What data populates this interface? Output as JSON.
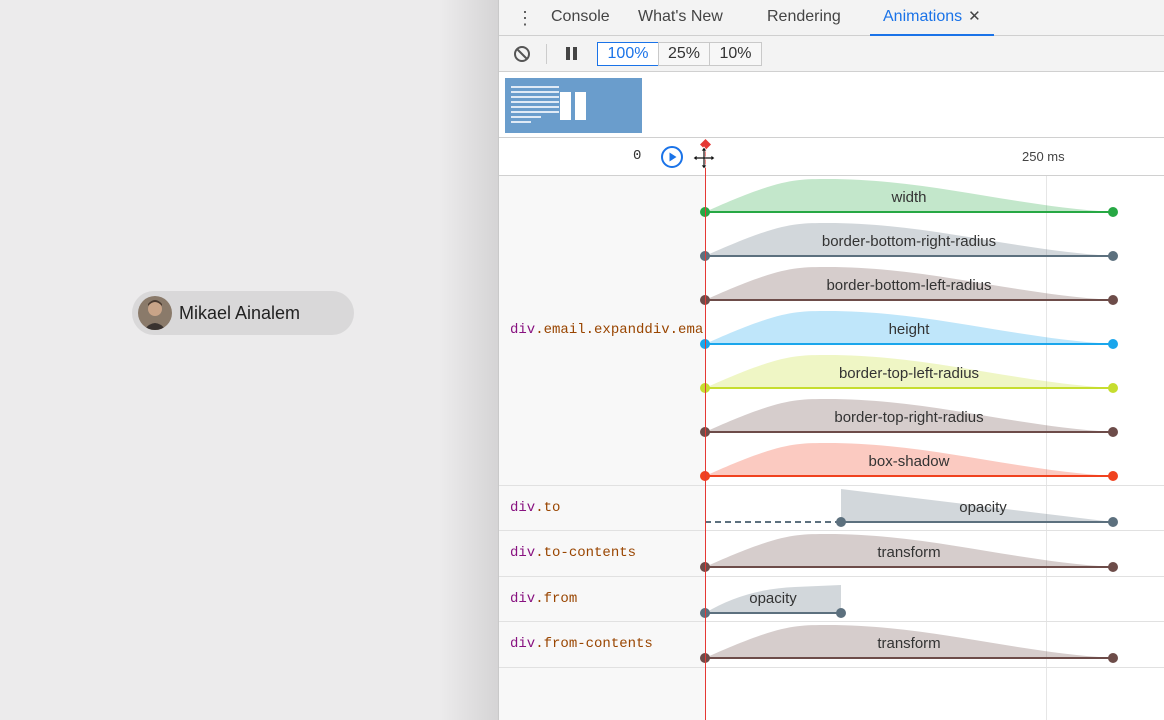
{
  "page": {
    "user_name": "Mikael Ainalem"
  },
  "devtools": {
    "tabs": [
      {
        "label": "Console"
      },
      {
        "label": "What's New"
      },
      {
        "label": "Rendering"
      },
      {
        "label": "Animations",
        "close": "✕"
      }
    ],
    "speeds": [
      "100%",
      "25%",
      "10%"
    ],
    "selected_speed": "100%",
    "timeline": {
      "start_label": "0",
      "tick_label": "250 ms"
    },
    "rows": [
      {
        "tag": "div",
        "label_rest": ".email.expanddiv.email.expand",
        "animations": [
          {
            "name": "width",
            "color": "#27a844"
          },
          {
            "name": "border-bottom-right-radius",
            "color": "#5c707e"
          },
          {
            "name": "border-bottom-left-radius",
            "color": "#6d4c49"
          },
          {
            "name": "height",
            "color": "#1aa6ec"
          },
          {
            "name": "border-top-left-radius",
            "color": "#c6dd2f"
          },
          {
            "name": "border-top-right-radius",
            "color": "#6d4c49"
          },
          {
            "name": "box-shadow",
            "color": "#f0421f"
          }
        ]
      },
      {
        "tag": "div",
        "label_rest": ".to",
        "animations": [
          {
            "name": "opacity",
            "color": "#5c707e",
            "delayed": true
          }
        ]
      },
      {
        "tag": "div",
        "label_rest": ".to-contents",
        "animations": [
          {
            "name": "transform",
            "color": "#6d4c49"
          }
        ]
      },
      {
        "tag": "div",
        "label_rest": ".from",
        "animations": [
          {
            "name": "opacity",
            "color": "#5c707e",
            "short": true
          }
        ]
      },
      {
        "tag": "div",
        "label_rest": ".from-contents",
        "animations": [
          {
            "name": "transform",
            "color": "#6d4c49"
          }
        ]
      }
    ]
  }
}
